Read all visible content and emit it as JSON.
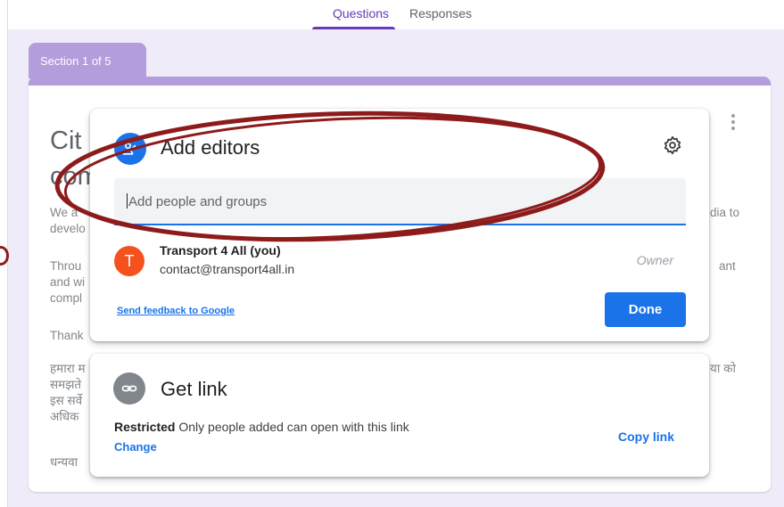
{
  "tabs": {
    "questions": "Questions",
    "responses": "Responses"
  },
  "section": {
    "label": "Section 1 of 5"
  },
  "background_form": {
    "title_line1": "Cit",
    "title_line2": "com",
    "para1_line1": "We a",
    "para1_line2": "develo",
    "para1_right": "dia to",
    "para2_line1": "Throu",
    "para2_line2": "and wi",
    "para2_line3": "compl",
    "para2_right": "ant",
    "para3_line1": "Thank",
    "hindi_line1": "हमारा म",
    "hindi_line2": "समझते",
    "hindi_line3": "इस सर्वे",
    "hindi_line4": "अधिक",
    "hindi_right": "या को",
    "hindi_thanks": "धन्यवा"
  },
  "add_editors": {
    "title": "Add editors",
    "input_placeholder": "Add people and groups",
    "user": {
      "initial": "T",
      "name": "Transport 4 All (you)",
      "email": "contact@transport4all.in",
      "role": "Owner"
    },
    "feedback_link": "Send feedback to Google",
    "done_label": "Done"
  },
  "get_link": {
    "title": "Get link",
    "restricted_bold": "Restricted",
    "restricted_text": " Only people added can open with this link",
    "change_label": "Change",
    "copy_label": "Copy link"
  },
  "colors": {
    "accent": "#673ab7",
    "header_band": "#b39ddb",
    "primary_blue": "#1a73e8",
    "avatar_orange": "#f4511e",
    "annotation_red": "#8e1b1b"
  }
}
